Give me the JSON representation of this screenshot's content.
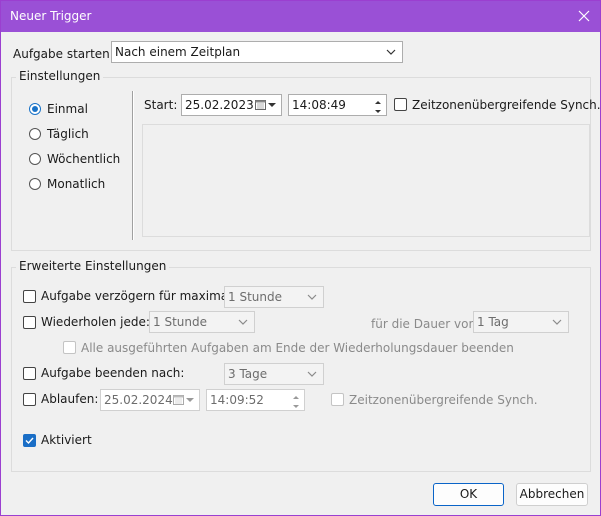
{
  "window": {
    "title": "Neuer Trigger"
  },
  "task_start": {
    "label": "Aufgabe starten:",
    "value": "Nach einem Zeitplan"
  },
  "settings": {
    "title": "Einstellungen",
    "radios": [
      {
        "label": "Einmal",
        "checked": true
      },
      {
        "label": "Täglich",
        "checked": false
      },
      {
        "label": "Wöchentlich",
        "checked": false
      },
      {
        "label": "Monatlich",
        "checked": false
      }
    ],
    "start_label": "Start:",
    "start_date": "25.02.2023",
    "start_time": "14:08:49",
    "sync_label": "Zeitzonenübergreifende Synch."
  },
  "advanced": {
    "title": "Erweiterte Einstellungen",
    "delay_label": "Aufgabe verzögern für maximal:",
    "delay_value": "1 Stunde",
    "repeat_label": "Wiederholen jede:",
    "repeat_value": "1 Stunde",
    "duration_label": "für die Dauer von:",
    "duration_value": "1 Tag",
    "stop_all_label": "Alle ausgeführten Aufgaben am Ende der Wiederholungsdauer beenden",
    "stop_after_label": "Aufgabe beenden nach:",
    "stop_after_value": "3 Tage",
    "expire_label": "Ablaufen:",
    "expire_date": "25.02.2024",
    "expire_time": "14:09:52",
    "expire_sync_label": "Zeitzonenübergreifende Synch.",
    "enabled_label": "Aktiviert"
  },
  "buttons": {
    "ok": "OK",
    "cancel": "Abbrechen"
  },
  "colors": {
    "titlebar": "#9a50d6",
    "accent": "#1a6ec6"
  }
}
